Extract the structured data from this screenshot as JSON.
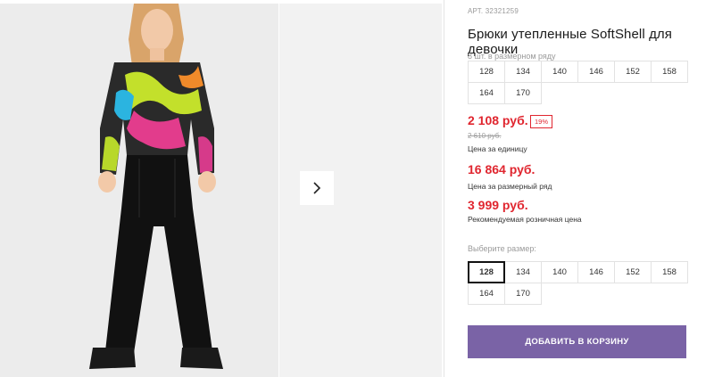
{
  "product": {
    "sku_label": "АРТ.",
    "sku": "32321259",
    "title": "Брюки утепленные SoftShell для девочки"
  },
  "pack": {
    "label": "8 шт. в размерном ряду",
    "sizes": [
      "128",
      "134",
      "140",
      "146",
      "152",
      "158",
      "164",
      "170"
    ]
  },
  "prices": {
    "unit_price": "2 108 руб.",
    "discount": "19%",
    "old_price": "2 610 руб.",
    "unit_caption": "Цена за единицу",
    "pack_price": "16 864 руб.",
    "pack_caption": "Цена за размерный ряд",
    "retail_price": "3 999 руб.",
    "retail_caption": "Рекомендуемая розничная цена"
  },
  "size_select": {
    "label": "Выберите размер:",
    "sizes": [
      "128",
      "134",
      "140",
      "146",
      "152",
      "158",
      "164",
      "170"
    ],
    "selected": "128"
  },
  "actions": {
    "add_to_cart": "ДОБАВИТЬ В КОРЗИНУ"
  },
  "colors": {
    "accent_red": "#e0262f",
    "button_purple": "#7a63a6"
  },
  "icons": {
    "next": "chevron-right-icon"
  }
}
